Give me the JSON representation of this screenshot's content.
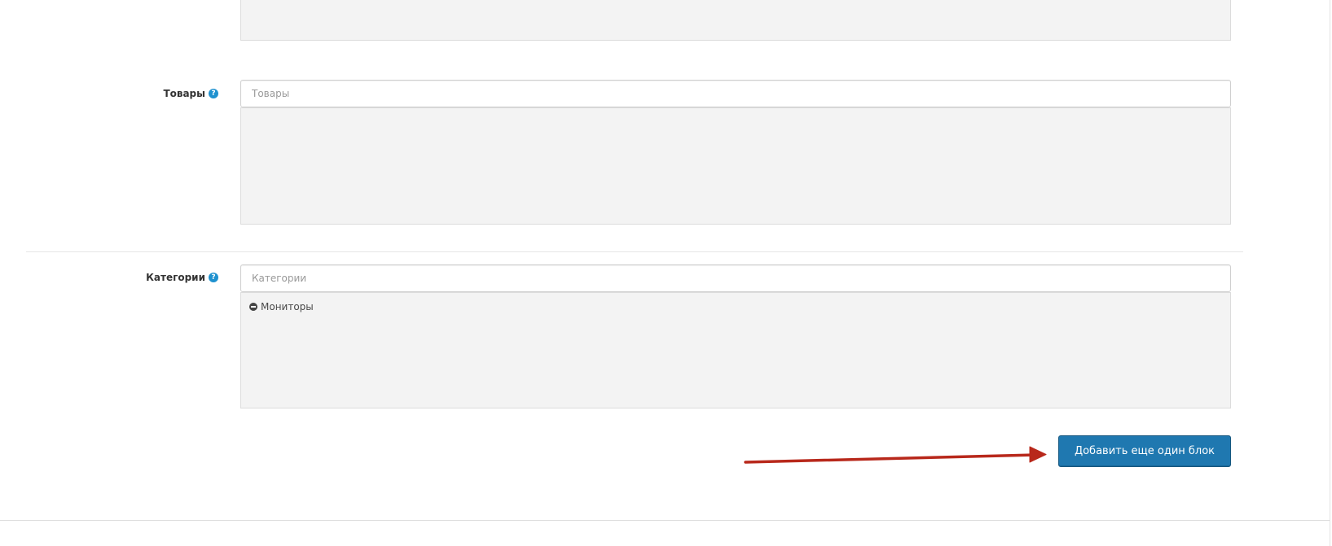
{
  "products": {
    "label": "Товары",
    "placeholder": "Товары",
    "value": ""
  },
  "categories": {
    "label": "Категории",
    "placeholder": "Категории",
    "value": "",
    "selected": [
      {
        "name": "Мониторы"
      }
    ]
  },
  "actions": {
    "add_block_label": "Добавить еще один блок"
  },
  "icons": {
    "help": "question-circle-icon",
    "remove": "minus-circle-icon",
    "annotation": "red-arrow"
  },
  "colors": {
    "primary_button": "#1f78b0",
    "help_icon": "#1e91cf",
    "annotation_arrow": "#b8281b",
    "well_background": "#f3f3f3"
  }
}
